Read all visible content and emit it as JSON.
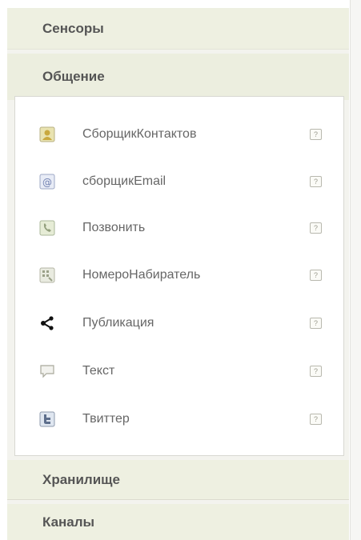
{
  "categories": {
    "sensors": "Сенсоры",
    "social": "Общение",
    "storage": "Хранилище",
    "channels": "Каналы"
  },
  "components": [
    {
      "label": "СборщикКонтактов",
      "icon": "contact-picker-icon",
      "help": "?"
    },
    {
      "label": "сборщикEmail",
      "icon": "email-picker-icon",
      "help": "?"
    },
    {
      "label": "Позвонить",
      "icon": "phone-call-icon",
      "help": "?"
    },
    {
      "label": "НомероНабиратель",
      "icon": "phone-number-picker-icon",
      "help": "?"
    },
    {
      "label": "Публикация",
      "icon": "share-icon",
      "help": "?"
    },
    {
      "label": "Текст",
      "icon": "texting-icon",
      "help": "?"
    },
    {
      "label": "Твиттер",
      "icon": "twitter-icon",
      "help": "?"
    }
  ]
}
